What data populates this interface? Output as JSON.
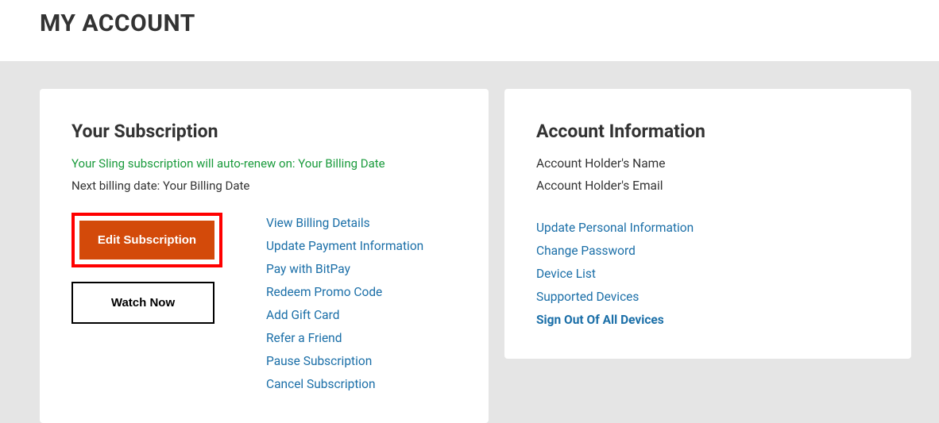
{
  "page": {
    "title": "MY ACCOUNT"
  },
  "subscription": {
    "card_title": "Your Subscription",
    "renewal_text": "Your Sling subscription will auto-renew on: Your Billing Date",
    "billing_text": "Next billing date: Your Billing Date",
    "edit_button": "Edit Subscription",
    "watch_button": "Watch Now",
    "links": {
      "view_billing": "View Billing Details",
      "update_payment": "Update Payment Information",
      "pay_bitpay": "Pay with BitPay",
      "redeem_promo": "Redeem Promo Code",
      "add_gift": "Add Gift Card",
      "refer_friend": "Refer a Friend",
      "pause_sub": "Pause Subscription",
      "cancel_sub": "Cancel Subscription"
    }
  },
  "account": {
    "card_title": "Account Information",
    "holder_name": "Account Holder's Name",
    "holder_email": "Account Holder's Email",
    "links": {
      "update_personal": "Update Personal Information",
      "change_password": "Change Password",
      "device_list": "Device List",
      "supported_devices": "Supported Devices",
      "sign_out_all": "Sign Out Of All Devices"
    }
  }
}
